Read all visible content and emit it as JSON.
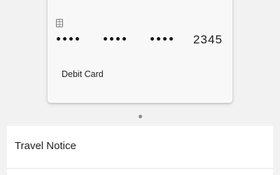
{
  "card": {
    "masked_groups": 3,
    "last4": "2345",
    "type_label": "Debit Card"
  },
  "carousel": {
    "current_page": 1
  },
  "list": {
    "items": [
      {
        "label": "Travel Notice"
      }
    ]
  },
  "colors": {
    "background": "#f2f2f2",
    "card_background": "#f8f8f8",
    "text": "#222222",
    "pager_dot": "#8b8b8b",
    "list_background": "#ffffff"
  },
  "icons": {
    "chip": "card-chip-icon"
  }
}
